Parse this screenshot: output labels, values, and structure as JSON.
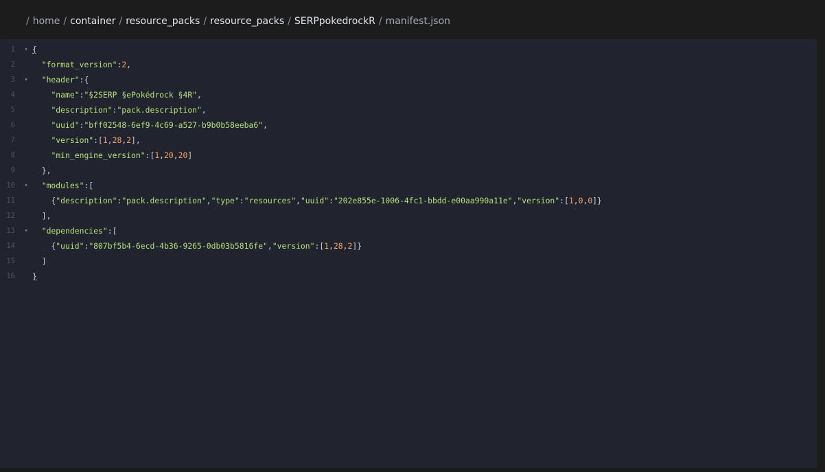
{
  "breadcrumb": {
    "root": "home",
    "items": [
      "container",
      "resource_packs",
      "resource_packs",
      "SERPpokedrockR"
    ],
    "current": "manifest.json"
  },
  "editor": {
    "line_numbers": [
      "1",
      "2",
      "3",
      "4",
      "5",
      "6",
      "7",
      "8",
      "9",
      "10",
      "11",
      "12",
      "13",
      "14",
      "15",
      "16"
    ],
    "fold_icon": "triangle-down",
    "colors": {
      "key_string": "#b5e07a",
      "number": "#f9a35e",
      "punctuation": "#c9ccd4",
      "background": "#21242e",
      "line_number": "#4d5262"
    },
    "lines": [
      {
        "indent": "",
        "tokens": [
          {
            "t": "p",
            "v": "{"
          }
        ]
      },
      {
        "indent": "  ",
        "tokens": [
          {
            "t": "k",
            "v": "\"format_version\""
          },
          {
            "t": "p",
            "v": ":"
          },
          {
            "t": "n",
            "v": "2"
          },
          {
            "t": "p",
            "v": ","
          }
        ]
      },
      {
        "indent": "  ",
        "tokens": [
          {
            "t": "k",
            "v": "\"header\""
          },
          {
            "t": "p",
            "v": ":{"
          }
        ]
      },
      {
        "indent": "    ",
        "tokens": [
          {
            "t": "k",
            "v": "\"name\""
          },
          {
            "t": "p",
            "v": ":"
          },
          {
            "t": "s",
            "v": "\"§2SERP §ePokédrock §4R\""
          },
          {
            "t": "p",
            "v": ","
          }
        ]
      },
      {
        "indent": "    ",
        "tokens": [
          {
            "t": "k",
            "v": "\"description\""
          },
          {
            "t": "p",
            "v": ":"
          },
          {
            "t": "s",
            "v": "\"pack.description\""
          },
          {
            "t": "p",
            "v": ","
          }
        ]
      },
      {
        "indent": "    ",
        "tokens": [
          {
            "t": "k",
            "v": "\"uuid\""
          },
          {
            "t": "p",
            "v": ":"
          },
          {
            "t": "s",
            "v": "\"bff02548-6ef9-4c69-a527-b9b0b58eeba6\""
          },
          {
            "t": "p",
            "v": ","
          }
        ]
      },
      {
        "indent": "    ",
        "tokens": [
          {
            "t": "k",
            "v": "\"version\""
          },
          {
            "t": "p",
            "v": ":["
          },
          {
            "t": "n",
            "v": "1"
          },
          {
            "t": "p",
            "v": ","
          },
          {
            "t": "n",
            "v": "28"
          },
          {
            "t": "p",
            "v": ","
          },
          {
            "t": "n",
            "v": "2"
          },
          {
            "t": "p",
            "v": "],"
          }
        ]
      },
      {
        "indent": "    ",
        "tokens": [
          {
            "t": "k",
            "v": "\"min_engine_version\""
          },
          {
            "t": "p",
            "v": ":["
          },
          {
            "t": "n",
            "v": "1"
          },
          {
            "t": "p",
            "v": ","
          },
          {
            "t": "n",
            "v": "20"
          },
          {
            "t": "p",
            "v": ","
          },
          {
            "t": "n",
            "v": "20"
          },
          {
            "t": "p",
            "v": "]"
          }
        ]
      },
      {
        "indent": "  ",
        "tokens": [
          {
            "t": "p",
            "v": "},"
          }
        ]
      },
      {
        "indent": "  ",
        "tokens": [
          {
            "t": "k",
            "v": "\"modules\""
          },
          {
            "t": "p",
            "v": ":["
          }
        ]
      },
      {
        "indent": "    ",
        "tokens": [
          {
            "t": "p",
            "v": "{"
          },
          {
            "t": "k",
            "v": "\"description\""
          },
          {
            "t": "p",
            "v": ":"
          },
          {
            "t": "s",
            "v": "\"pack.description\""
          },
          {
            "t": "p",
            "v": ","
          },
          {
            "t": "k",
            "v": "\"type\""
          },
          {
            "t": "p",
            "v": ":"
          },
          {
            "t": "s",
            "v": "\"resources\""
          },
          {
            "t": "p",
            "v": ","
          },
          {
            "t": "k",
            "v": "\"uuid\""
          },
          {
            "t": "p",
            "v": ":"
          },
          {
            "t": "s",
            "v": "\"202e855e-1006-4fc1-bbdd-e00aa990a11e\""
          },
          {
            "t": "p",
            "v": ","
          },
          {
            "t": "k",
            "v": "\"version\""
          },
          {
            "t": "p",
            "v": ":["
          },
          {
            "t": "n",
            "v": "1"
          },
          {
            "t": "p",
            "v": ","
          },
          {
            "t": "n",
            "v": "0"
          },
          {
            "t": "p",
            "v": ","
          },
          {
            "t": "n",
            "v": "0"
          },
          {
            "t": "p",
            "v": "]}"
          }
        ]
      },
      {
        "indent": "  ",
        "tokens": [
          {
            "t": "p",
            "v": "],"
          }
        ]
      },
      {
        "indent": "  ",
        "tokens": [
          {
            "t": "k",
            "v": "\"dependencies\""
          },
          {
            "t": "p",
            "v": ":["
          }
        ]
      },
      {
        "indent": "    ",
        "tokens": [
          {
            "t": "p",
            "v": "{"
          },
          {
            "t": "k",
            "v": "\"uuid\""
          },
          {
            "t": "p",
            "v": ":"
          },
          {
            "t": "s",
            "v": "\"807bf5b4-6ecd-4b36-9265-0db03b5816fe\""
          },
          {
            "t": "p",
            "v": ","
          },
          {
            "t": "k",
            "v": "\"version\""
          },
          {
            "t": "p",
            "v": ":["
          },
          {
            "t": "n",
            "v": "1"
          },
          {
            "t": "p",
            "v": ","
          },
          {
            "t": "n",
            "v": "28"
          },
          {
            "t": "p",
            "v": ","
          },
          {
            "t": "n",
            "v": "2"
          },
          {
            "t": "p",
            "v": "]}"
          }
        ]
      },
      {
        "indent": "  ",
        "tokens": [
          {
            "t": "p",
            "v": "]"
          }
        ]
      },
      {
        "indent": "",
        "tokens": [
          {
            "t": "p",
            "v": "}"
          }
        ]
      }
    ],
    "foldable_lines": [
      1,
      3,
      10,
      13
    ]
  }
}
